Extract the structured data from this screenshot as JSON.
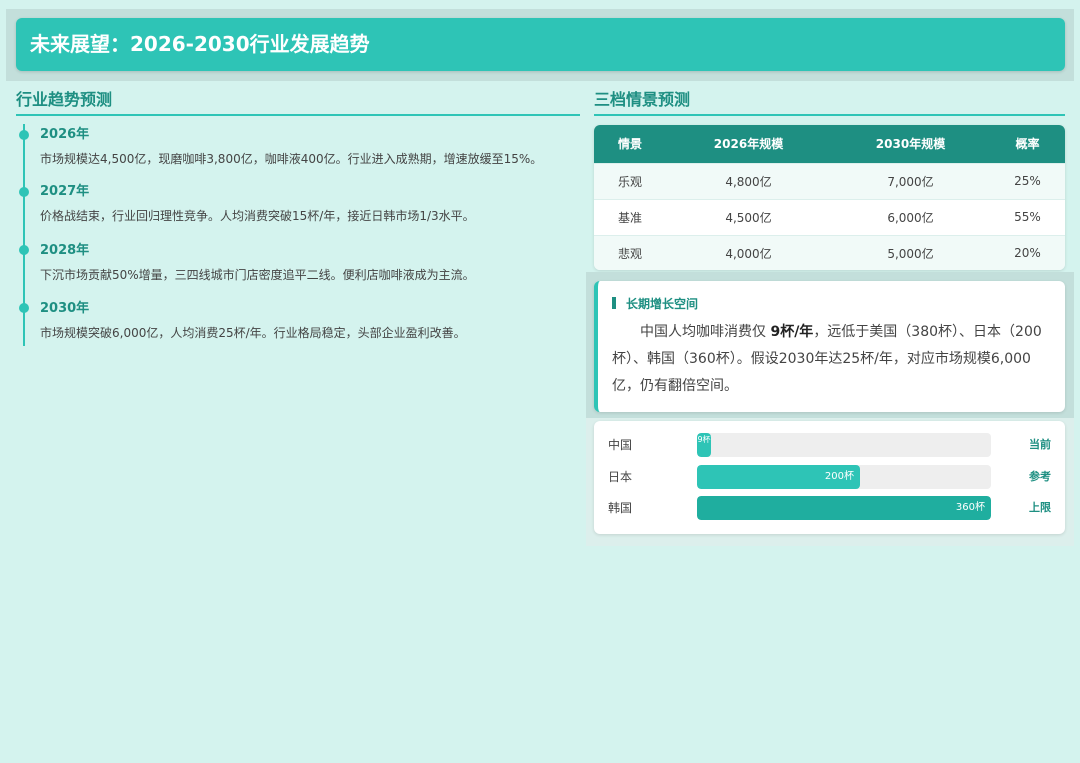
{
  "header": {
    "title": "未来展望：2026-2030行业发展趋势"
  },
  "timeline": {
    "title": "行业趋势预测",
    "items": [
      {
        "year": "2026年",
        "text": "市场规模达4,500亿，现磨咖啡3,800亿，咖啡液400亿。行业进入成熟期，增速放缓至15%。"
      },
      {
        "year": "2027年",
        "text": "价格战结束，行业回归理性竞争。人均消费突破15杯/年，接近日韩市场1/3水平。"
      },
      {
        "year": "2028年",
        "text": "下沉市场贡献50%增量，三四线城市门店密度追平二线。便利店咖啡液成为主流。"
      },
      {
        "year": "2030年",
        "text": "市场规模突破6,000亿，人均消费25杯/年。行业格局稳定，头部企业盈利改善。"
      }
    ]
  },
  "scenarios": {
    "title": "三档情景预测",
    "headers": [
      "情景",
      "2026年规模",
      "2030年规模",
      "概率"
    ],
    "rows": [
      [
        "乐观",
        "4,800亿",
        "7,000亿",
        "25%"
      ],
      [
        "基准",
        "4,500亿",
        "6,000亿",
        "55%"
      ],
      [
        "悲观",
        "4,000亿",
        "5,000亿",
        "20%"
      ]
    ]
  },
  "note": {
    "title": "长期增长空间",
    "body_pre": "中国人均咖啡消费仅 ",
    "body_bold": "9杯/年",
    "body_post": "，远低于美国（380杯）、日本（200杯）、韩国（360杯）。假设2030年达25杯/年，对应市场规模6,000亿，仍有翻倍空间。"
  },
  "comparison": {
    "max": 360,
    "bars": [
      {
        "label": "中国",
        "value": 9,
        "value_label": "9杯",
        "tag": "当前",
        "color": "#2ec4b6"
      },
      {
        "label": "日本",
        "value": 200,
        "value_label": "200杯",
        "tag": "参考",
        "color": "#2ec4b6"
      },
      {
        "label": "韩国",
        "value": 360,
        "value_label": "360杯",
        "tag": "上限",
        "color": "#1fae9f"
      }
    ]
  }
}
